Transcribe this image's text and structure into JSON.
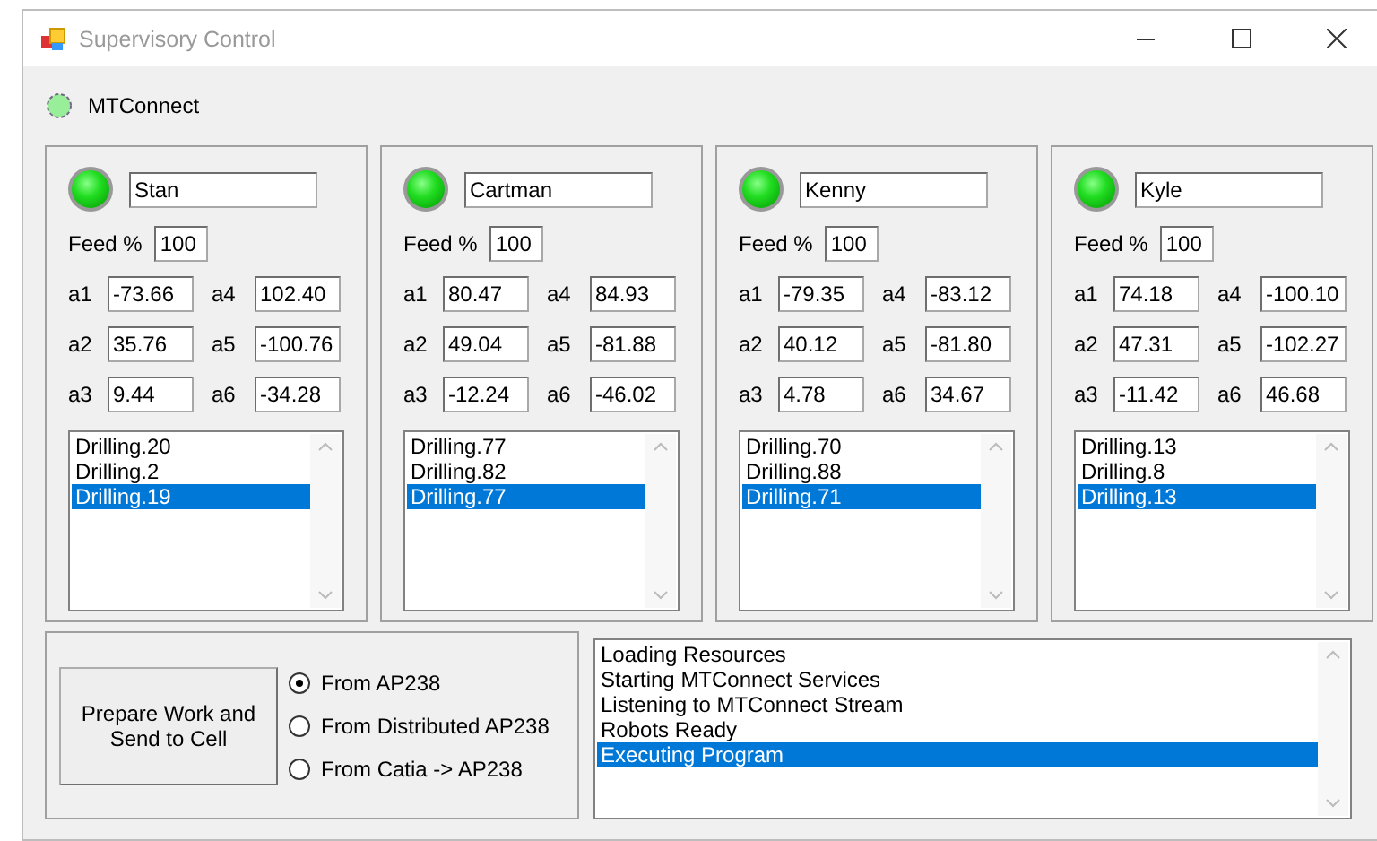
{
  "window": {
    "title": "Supervisory Control"
  },
  "mtconnect": {
    "label": "MTConnect"
  },
  "robots": [
    {
      "name": "Stan",
      "active": true,
      "feed_label": "Feed %",
      "feed": "100",
      "axes": [
        {
          "label": "a1",
          "value": "-73.66"
        },
        {
          "label": "a4",
          "value": "102.40"
        },
        {
          "label": "a2",
          "value": "35.76"
        },
        {
          "label": "a5",
          "value": "-100.76"
        },
        {
          "label": "a3",
          "value": "9.44"
        },
        {
          "label": "a6",
          "value": "-34.28"
        }
      ],
      "programs": [
        {
          "label": "Drilling.20",
          "selected": false
        },
        {
          "label": "Drilling.2",
          "selected": false
        },
        {
          "label": "Drilling.19",
          "selected": true
        }
      ]
    },
    {
      "name": "Cartman",
      "active": true,
      "feed_label": "Feed %",
      "feed": "100",
      "axes": [
        {
          "label": "a1",
          "value": "80.47"
        },
        {
          "label": "a4",
          "value": "84.93"
        },
        {
          "label": "a2",
          "value": "49.04"
        },
        {
          "label": "a5",
          "value": "-81.88"
        },
        {
          "label": "a3",
          "value": "-12.24"
        },
        {
          "label": "a6",
          "value": "-46.02"
        }
      ],
      "programs": [
        {
          "label": "Drilling.77",
          "selected": false
        },
        {
          "label": "Drilling.82",
          "selected": false
        },
        {
          "label": "Drilling.77",
          "selected": true
        }
      ]
    },
    {
      "name": "Kenny",
      "active": true,
      "feed_label": "Feed %",
      "feed": "100",
      "axes": [
        {
          "label": "a1",
          "value": "-79.35"
        },
        {
          "label": "a4",
          "value": "-83.12"
        },
        {
          "label": "a2",
          "value": "40.12"
        },
        {
          "label": "a5",
          "value": "-81.80"
        },
        {
          "label": "a3",
          "value": "4.78"
        },
        {
          "label": "a6",
          "value": "34.67"
        }
      ],
      "programs": [
        {
          "label": "Drilling.70",
          "selected": false
        },
        {
          "label": "Drilling.88",
          "selected": false
        },
        {
          "label": "Drilling.71",
          "selected": true
        }
      ]
    },
    {
      "name": "Kyle",
      "active": true,
      "feed_label": "Feed %",
      "feed": "100",
      "axes": [
        {
          "label": "a1",
          "value": "74.18"
        },
        {
          "label": "a4",
          "value": "-100.10"
        },
        {
          "label": "a2",
          "value": "47.31"
        },
        {
          "label": "a5",
          "value": "-102.27"
        },
        {
          "label": "a3",
          "value": "-11.42"
        },
        {
          "label": "a6",
          "value": "46.68"
        }
      ],
      "programs": [
        {
          "label": "Drilling.13",
          "selected": false
        },
        {
          "label": "Drilling.8",
          "selected": false
        },
        {
          "label": "Drilling.13",
          "selected": true
        }
      ]
    }
  ],
  "prepare_button": "Prepare Work and Send to Cell",
  "sources": [
    {
      "label": "From AP238",
      "selected": true
    },
    {
      "label": "From Distributed AP238",
      "selected": false
    },
    {
      "label": "From Catia -> AP238",
      "selected": false
    }
  ],
  "log": [
    {
      "text": "Loading Resources",
      "selected": false
    },
    {
      "text": "Starting MTConnect Services",
      "selected": false
    },
    {
      "text": "Listening to MTConnect Stream",
      "selected": false
    },
    {
      "text": "Robots Ready",
      "selected": false
    },
    {
      "text": "Executing Program",
      "selected": true
    }
  ]
}
